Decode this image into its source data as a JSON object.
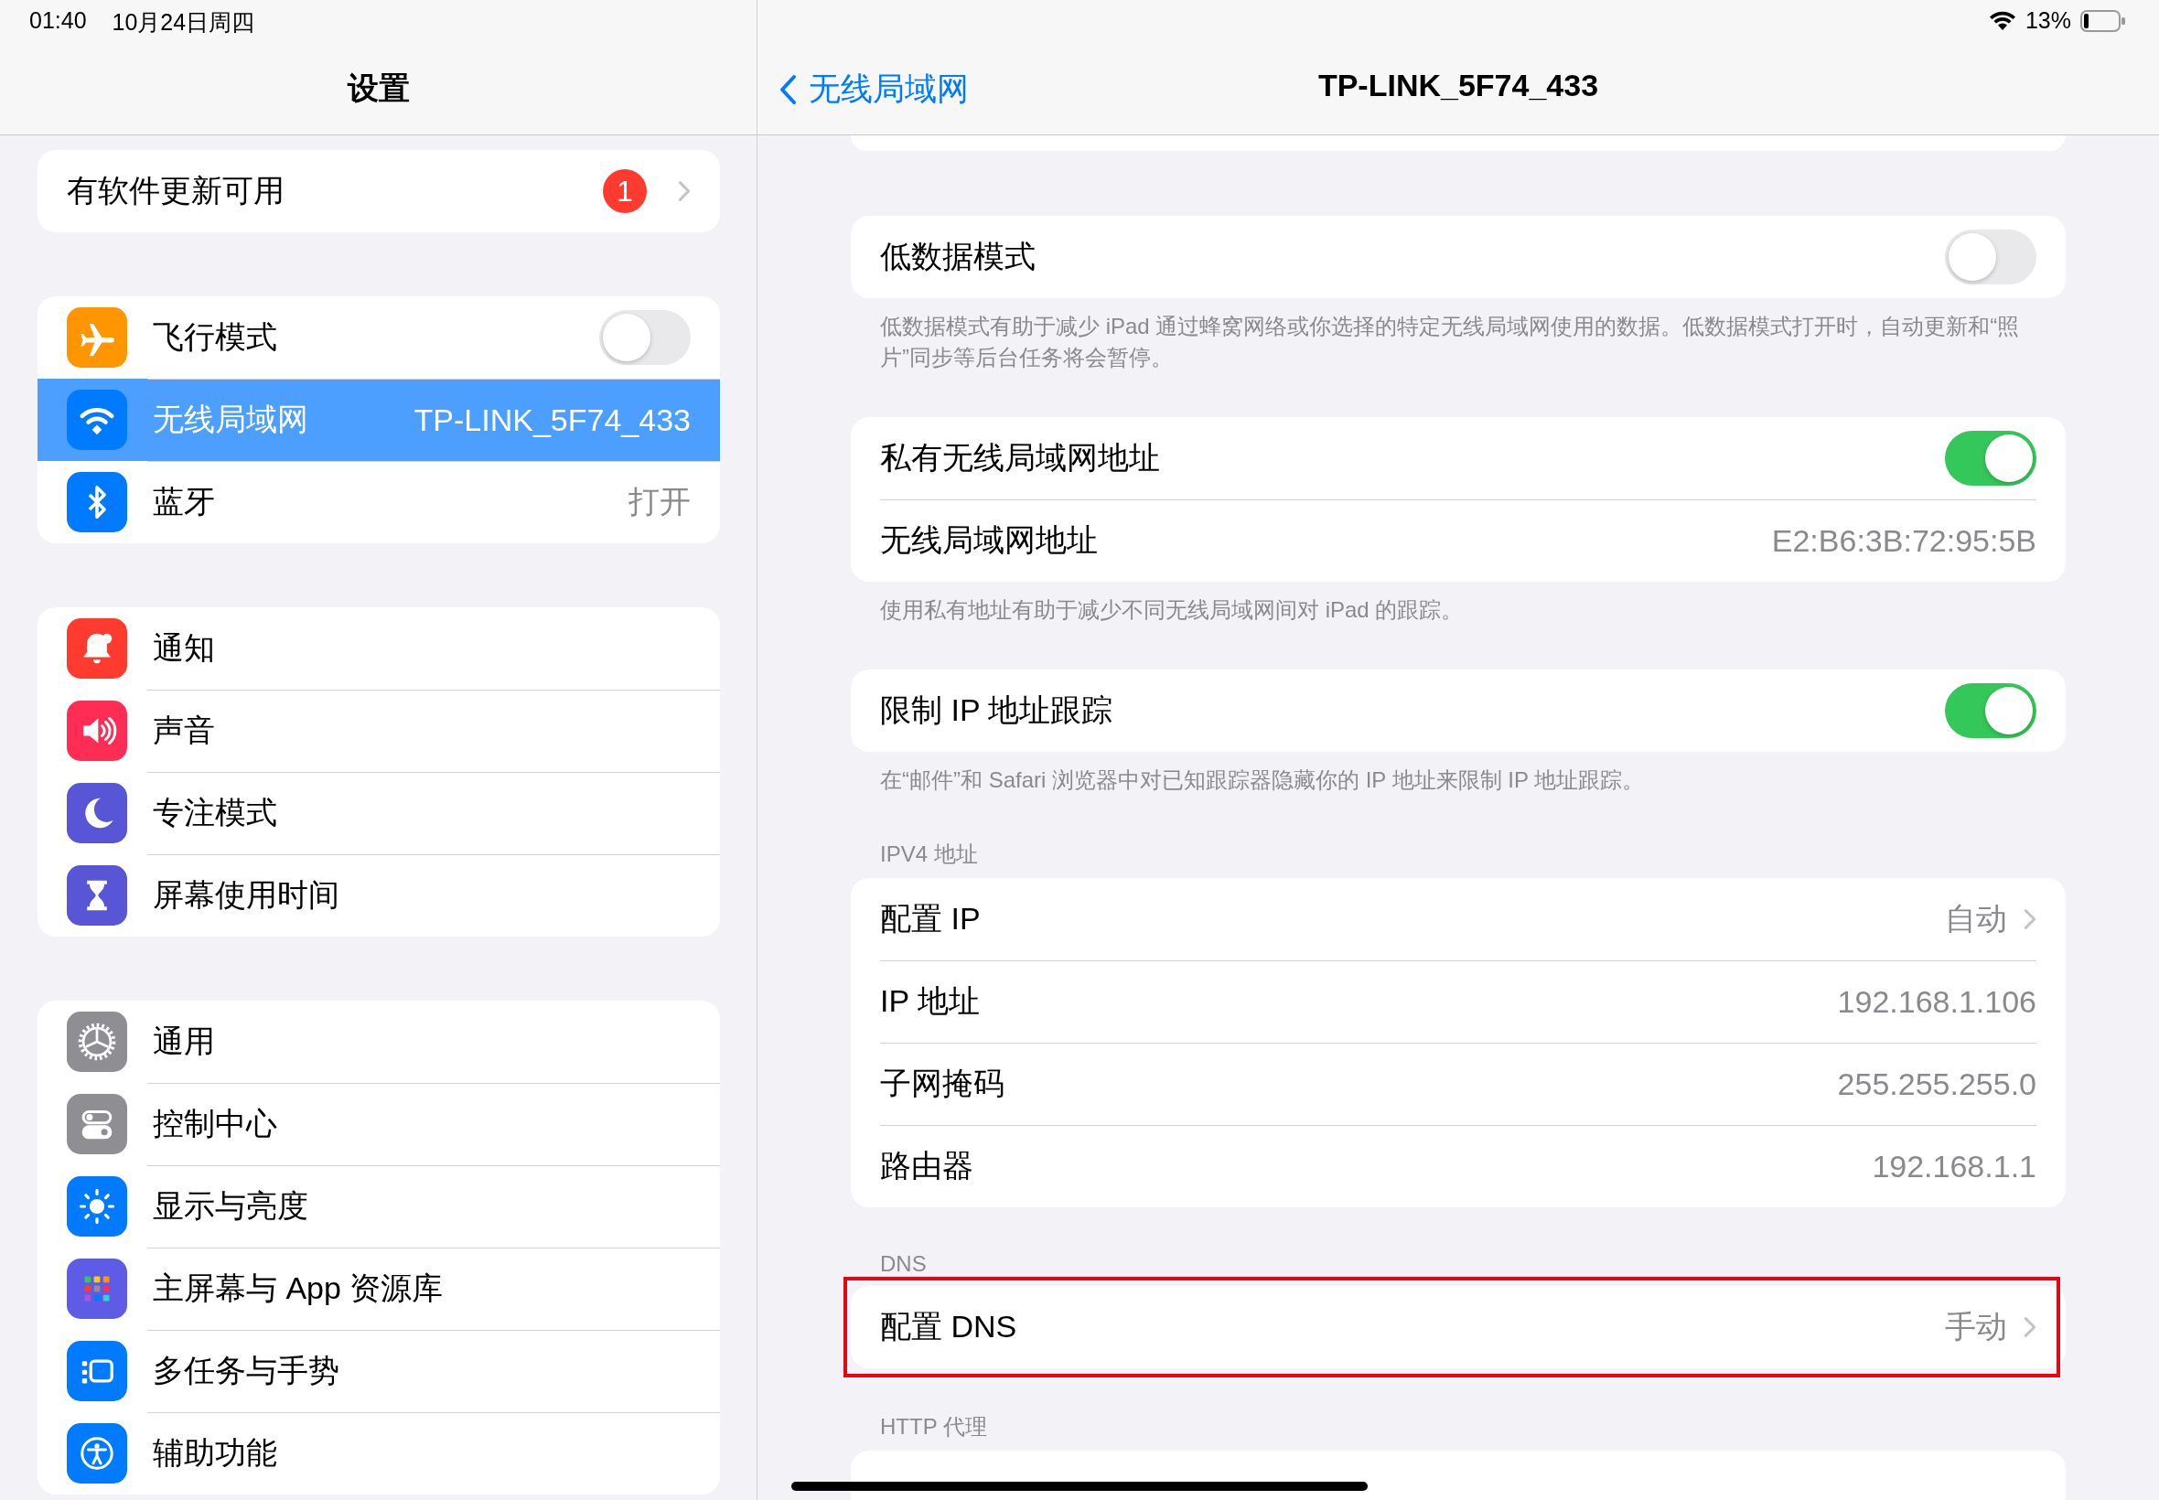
{
  "status_bar": {
    "time": "01:40",
    "date": "10月24日周四",
    "battery": "13%"
  },
  "sidebar": {
    "title": "设置",
    "groups": [
      {
        "items": [
          {
            "kind": "update",
            "label": "有软件更新可用",
            "badge": "1",
            "selected": false
          }
        ]
      },
      {
        "items": [
          {
            "kind": "toggle",
            "color": "#ff9500",
            "label": "飞行模式",
            "on": false,
            "selected": false
          },
          {
            "kind": "value",
            "color": "#007aff",
            "label": "无线局域网",
            "value": "TP-LINK_5F74_433",
            "selected": true
          },
          {
            "kind": "value",
            "color": "#007aff",
            "label": "蓝牙",
            "value": "打开",
            "selected": false
          }
        ]
      },
      {
        "items": [
          {
            "kind": "nav",
            "color": "#ff3b30",
            "label": "通知",
            "selected": false
          },
          {
            "kind": "nav",
            "color": "#ff2d55",
            "label": "声音",
            "selected": false
          },
          {
            "kind": "nav",
            "color": "#5856d6",
            "label": "专注模式",
            "selected": false
          },
          {
            "kind": "nav",
            "color": "#5856d6",
            "label": "屏幕使用时间",
            "selected": false
          }
        ]
      },
      {
        "items": [
          {
            "kind": "nav",
            "color": "#8e8e93",
            "label": "通用",
            "selected": false
          },
          {
            "kind": "nav",
            "color": "#8e8e93",
            "label": "控制中心",
            "selected": false
          },
          {
            "kind": "nav",
            "color": "#007aff",
            "label": "显示与亮度",
            "selected": false
          },
          {
            "kind": "nav",
            "color": "#5e5ce6",
            "label": "主屏幕与 App 资源库",
            "selected": false
          },
          {
            "kind": "nav",
            "color": "#007aff",
            "label": "多任务与手势",
            "selected": false
          },
          {
            "kind": "nav",
            "color": "#007aff",
            "label": "辅助功能",
            "selected": false
          }
        ]
      }
    ]
  },
  "detail": {
    "back": "无线局域网",
    "title": "TP-LINK_5F74_433",
    "sections": [
      {
        "highlighted": false,
        "rows": [
          {
            "kind": "toggle",
            "label": "低数据模式",
            "on": false
          }
        ],
        "footer": "低数据模式有助于减少 iPad 通过蜂窝网络或你选择的特定无线局域网使用的数据。低数据模式打开时，自动更新和“照片”同步等后台任务将会暂停。"
      },
      {
        "highlighted": false,
        "rows": [
          {
            "kind": "toggle",
            "label": "私有无线局域网地址",
            "on": true
          },
          {
            "kind": "value",
            "label": "无线局域网地址",
            "value": "E2:B6:3B:72:95:5B"
          }
        ],
        "footer": "使用私有地址有助于减少不同无线局域网间对 iPad 的跟踪。"
      },
      {
        "highlighted": false,
        "rows": [
          {
            "kind": "toggle",
            "label": "限制 IP 地址跟踪",
            "on": true
          }
        ],
        "footer": "在“邮件”和 Safari 浏览器中对已知跟踪器隐藏你的 IP 地址来限制 IP 地址跟踪。"
      },
      {
        "highlighted": false,
        "header": "IPV4 地址",
        "rows": [
          {
            "kind": "nav",
            "label": "配置 IP",
            "value": "自动"
          },
          {
            "kind": "value",
            "label": "IP 地址",
            "value": "192.168.1.106"
          },
          {
            "kind": "value",
            "label": "子网掩码",
            "value": "255.255.255.0"
          },
          {
            "kind": "value",
            "label": "路由器",
            "value": "192.168.1.1"
          }
        ]
      },
      {
        "highlighted": true,
        "header": "DNS",
        "rows": [
          {
            "kind": "nav",
            "label": "配置 DNS",
            "value": "手动"
          }
        ]
      },
      {
        "highlighted": false,
        "header": "HTTP 代理"
      }
    ]
  }
}
